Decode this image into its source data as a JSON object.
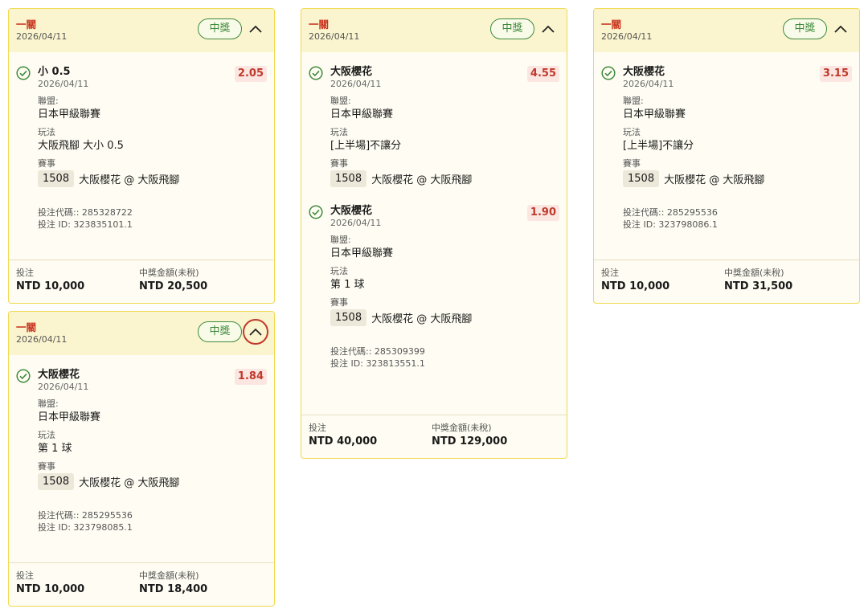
{
  "labels": {
    "league": "聯盟:",
    "play": "玩法",
    "event": "賽事",
    "stake": "投注",
    "payout": "中獎金額(未稅)"
  },
  "cards": [
    {
      "bet_type": "一關",
      "date": "2026/04/11",
      "badge": "中獎",
      "selections": [
        {
          "name": "小 0.5",
          "date": "2026/04/11",
          "odds": "2.05",
          "league": "日本甲級聯賽",
          "play": "大阪飛腳 大小 0.5",
          "event_code": "1508",
          "event_name": "大阪櫻花 @ 大阪飛腳"
        }
      ],
      "bet_code": "投注代碼:: 285328722",
      "bet_id": "投注 ID: 323835101.1",
      "stake": "NTD 10,000",
      "payout": "NTD 20,500"
    },
    {
      "bet_type": "一關",
      "date": "2026/04/11",
      "badge": "中獎",
      "selections": [
        {
          "name": "大阪櫻花",
          "date": "2026/04/11",
          "odds": "1.84",
          "league": "日本甲級聯賽",
          "play": "第 1 球",
          "event_code": "1508",
          "event_name": "大阪櫻花 @ 大阪飛腳"
        }
      ],
      "bet_code": "投注代碼:: 285295536",
      "bet_id": "投注 ID: 323798085.1",
      "stake": "NTD 10,000",
      "payout": "NTD 18,400"
    },
    {
      "bet_type": "一關",
      "date": "2026/04/11",
      "badge": "中獎",
      "selections": [
        {
          "name": "大阪櫻花",
          "date": "2026/04/11",
          "odds": "4.55",
          "league": "日本甲級聯賽",
          "play": "[上半場]不讓分",
          "event_code": "1508",
          "event_name": "大阪櫻花 @ 大阪飛腳"
        },
        {
          "name": "大阪櫻花",
          "date": "2026/04/11",
          "odds": "1.90",
          "league": "日本甲級聯賽",
          "play": "第 1 球",
          "event_code": "1508",
          "event_name": "大阪櫻花 @ 大阪飛腳"
        }
      ],
      "bet_code": "投注代碼:: 285309399",
      "bet_id": "投注 ID: 323813551.1",
      "stake": "NTD 40,000",
      "payout": "NTD 129,000"
    },
    {
      "bet_type": "一關",
      "date": "2026/04/11",
      "badge": "中獎",
      "selections": [
        {
          "name": "大阪櫻花",
          "date": "2026/04/11",
          "odds": "3.15",
          "league": "日本甲級聯賽",
          "play": "[上半場]不讓分",
          "event_code": "1508",
          "event_name": "大阪櫻花 @ 大阪飛腳"
        }
      ],
      "bet_code": "投注代碼:: 285295536",
      "bet_id": "投注 ID: 323798086.1",
      "stake": "NTD 10,000",
      "payout": "NTD 31,500"
    }
  ]
}
